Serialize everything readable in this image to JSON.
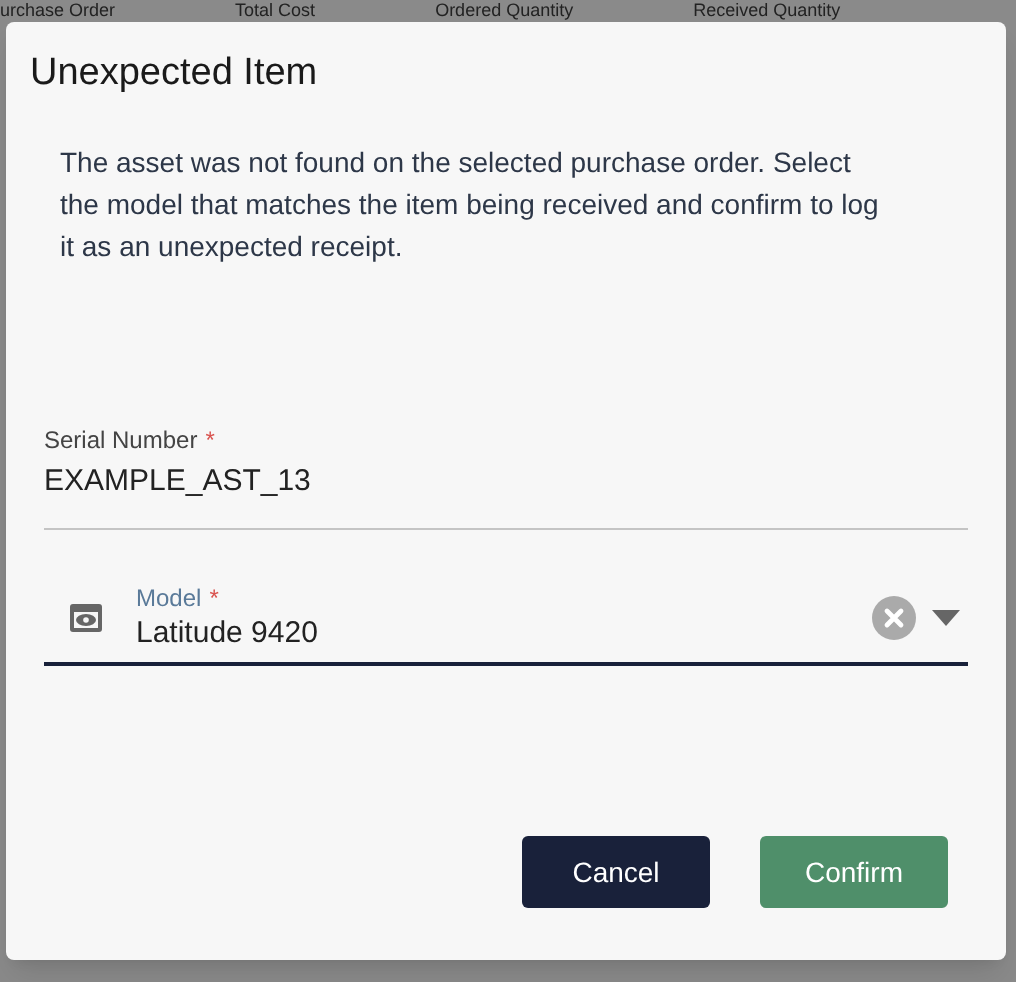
{
  "background_table": {
    "columns": [
      "urchase Order",
      "Total Cost",
      "Ordered Quantity",
      "Received Quantity"
    ]
  },
  "dialog": {
    "title": "Unexpected Item",
    "message": "The asset was not found on the selected purchase order. Select the model that matches the item being received and confirm to log it as an unexpected receipt.",
    "fields": [
      {
        "kind": "text",
        "label": "Serial Number",
        "required": true,
        "required_mark": "*",
        "value": "EXAMPLE_AST_13",
        "focused": false
      },
      {
        "kind": "select",
        "label": "Model",
        "required": true,
        "required_mark": "*",
        "value": "Latitude 9420",
        "focused": true
      }
    ],
    "buttons": [
      {
        "label": "Cancel",
        "kind": "secondary"
      },
      {
        "label": "Confirm",
        "kind": "primary"
      }
    ]
  }
}
